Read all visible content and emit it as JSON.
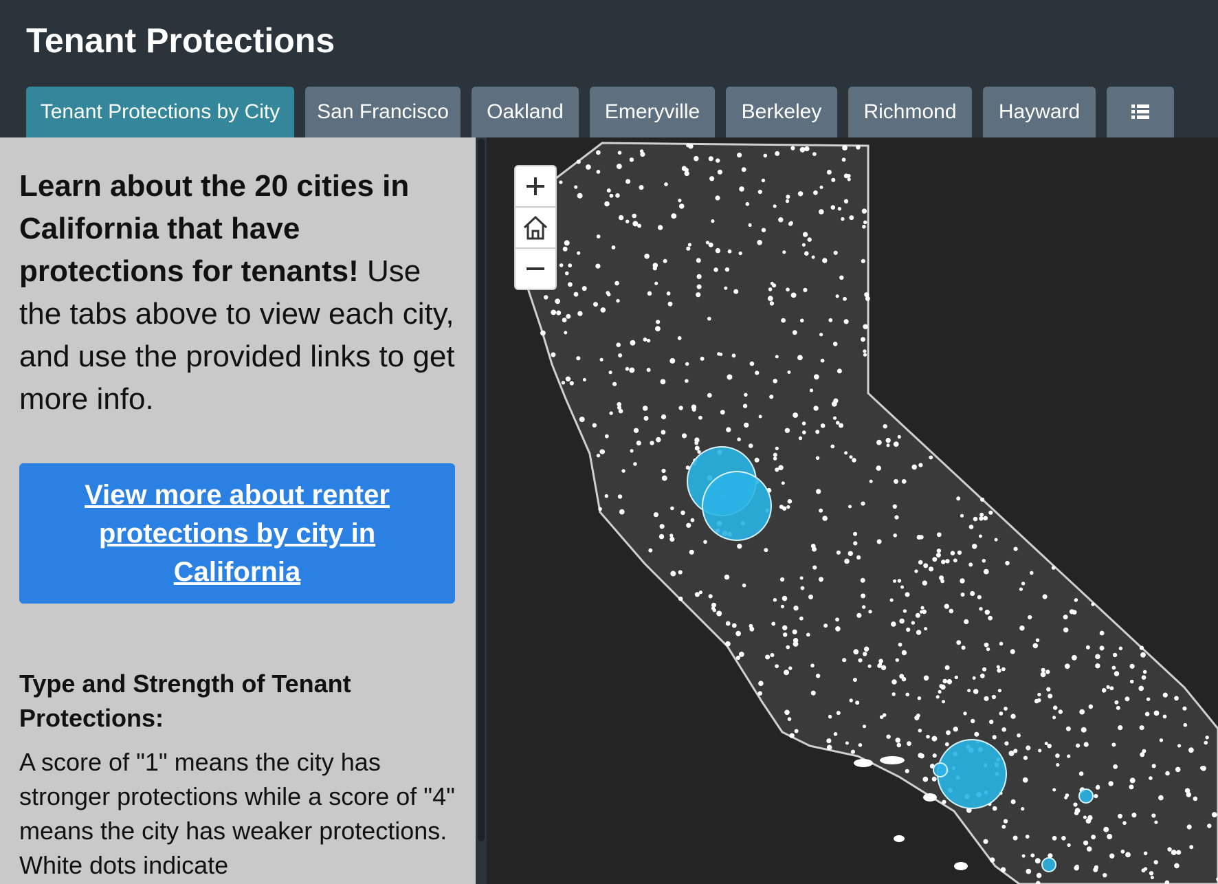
{
  "app": {
    "title": "Tenant Protections"
  },
  "tabs": [
    {
      "label": "Tenant Protections by City",
      "active": true
    },
    {
      "label": "San Francisco",
      "active": false
    },
    {
      "label": "Oakland",
      "active": false
    },
    {
      "label": "Emeryville",
      "active": false
    },
    {
      "label": "Berkeley",
      "active": false
    },
    {
      "label": "Richmond",
      "active": false
    },
    {
      "label": "Hayward",
      "active": false
    },
    {
      "icon": "list-icon",
      "active": false
    }
  ],
  "sidebar": {
    "intro_bold": "Learn about the 20 cities in California that have protections for tenants!",
    "intro_rest": " Use the tabs above to view each city, and use the provided links to get more info.",
    "cta_link": "View more about renter protections by city in California",
    "legend_title": "Type and Strength of Tenant Protections:",
    "legend_text": "A score of \"1\" means the city has stronger protections while a score of \"4\" means the city has weaker protections. White dots indicate"
  },
  "map": {
    "controls": {
      "zoom_in_icon": "plus-icon",
      "home_icon": "home-icon",
      "zoom_out_icon": "minus-icon"
    },
    "colors": {
      "ocean": "#242424",
      "land": "#3a3a3a",
      "border": "#d0d0d0",
      "point": "#ffffff",
      "highlight": "#2ab4e6"
    }
  }
}
